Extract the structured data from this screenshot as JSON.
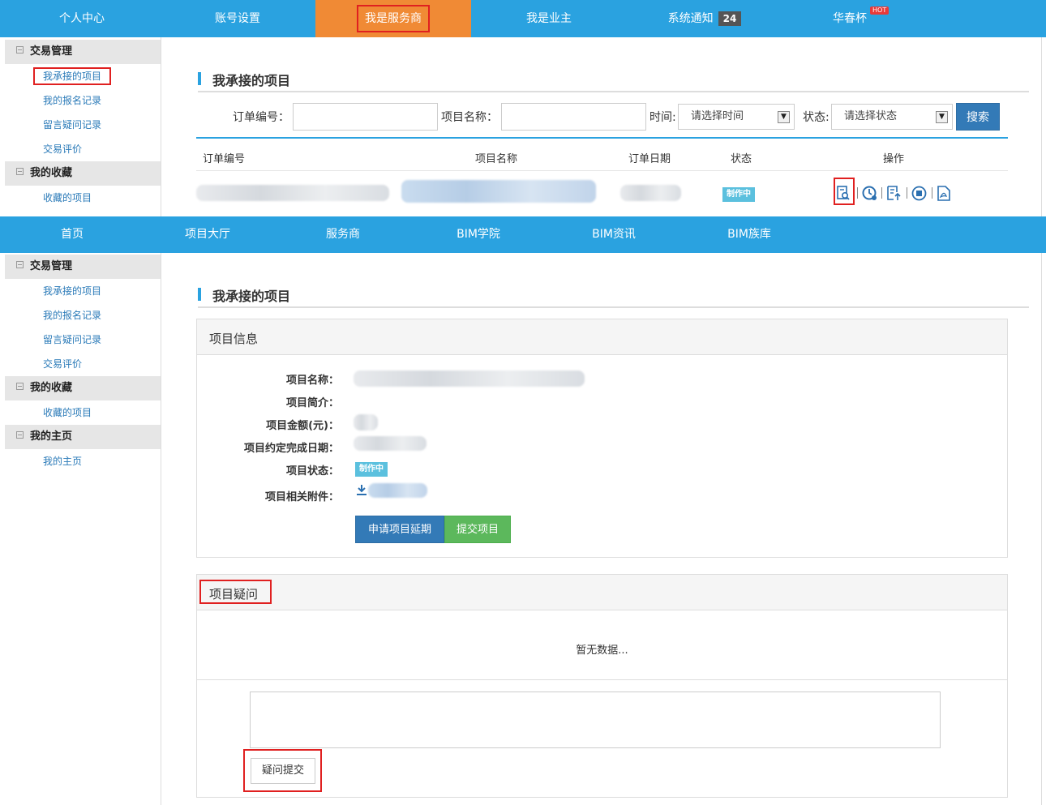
{
  "topnav": {
    "items": [
      "个人中心",
      "账号设置",
      "我是服务商",
      "我是业主",
      "系统通知",
      "华春杯"
    ],
    "notification_count": "24",
    "hot_badge": "HOT"
  },
  "subnav": {
    "items": [
      "首页",
      "项目大厅",
      "服务商",
      "BIM学院",
      "BIM资讯",
      "BIM族库"
    ]
  },
  "sidebar": {
    "trade": "交易管理",
    "my_projects": "我承接的项目",
    "signup_records": "我的报名记录",
    "question_records": "留言疑问记录",
    "trade_review": "交易评价",
    "favorites": "我的收藏",
    "fav_projects": "收藏的项目",
    "homepage": "我的主页",
    "my_homepage": "我的主页"
  },
  "page_title": "我承接的项目",
  "filter": {
    "order_no_label": "订单编号：",
    "project_name_label": "项目名称：",
    "time_label": "时间:",
    "time_value": "请选择时间",
    "status_label": "状态:",
    "status_value": "请选择状态",
    "search_button": "搜索"
  },
  "table": {
    "headers": [
      "订单编号",
      "项目名称",
      "订单日期",
      "状态",
      "操作"
    ],
    "row_status": "制作中"
  },
  "project_info": {
    "panel_title": "项目信息",
    "name_label": "项目名称：",
    "intro_label": "项目简介：",
    "amount_label": "项目金额(元)：",
    "due_label": "项目约定完成日期：",
    "status_label": "项目状态：",
    "status_value": "制作中",
    "attachment_label": "项目相关附件：",
    "extend_button": "申请项目延期",
    "submit_button": "提交项目"
  },
  "questions": {
    "panel_title": "项目疑问",
    "empty_text": "暂无数据...",
    "submit_button": "疑问提交"
  },
  "colors": {
    "nav_blue": "#2aa2e0",
    "active_orange": "#f08a35",
    "highlight_red": "#e02020"
  }
}
